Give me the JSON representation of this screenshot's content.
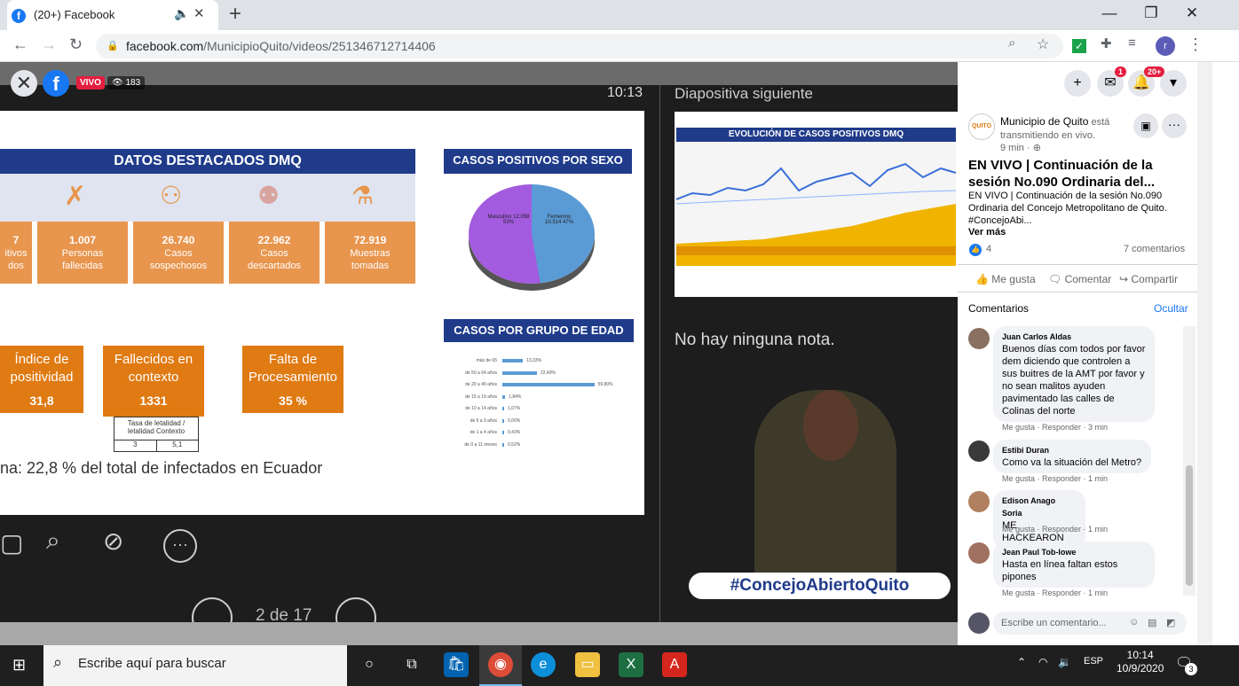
{
  "browser": {
    "tab_title": "(20+) Facebook",
    "url_host": "facebook.com",
    "url_path": "/MunicipioQuito/videos/251346712714406"
  },
  "video": {
    "live_label": "VIVO",
    "viewers": "183",
    "clock": "10:13",
    "next_slide_label": "Diapositiva siguiente",
    "no_notes": "No hay ninguna nota.",
    "pager": "2 de 17",
    "hashtag": "#ConcejoAbiertoQuito",
    "slide": {
      "banner": "DATOS DESTACADOS DMQ",
      "stats": [
        {
          "value": "7",
          "label": "itivos\ndos"
        },
        {
          "value": "1.007",
          "label": "Personas\nfallecidas"
        },
        {
          "value": "26.740",
          "label": "Casos\nsospechosos"
        },
        {
          "value": "22.962",
          "label": "Casos\ndescartados"
        },
        {
          "value": "72.919",
          "label": "Muestras\ntomadas"
        }
      ],
      "boxes": [
        {
          "title": "Índice de positividad",
          "value": "31,8"
        },
        {
          "title": "Fallecidos en contexto",
          "value": "1331"
        },
        {
          "title": "Falta de Procesamiento",
          "value": "35 %"
        }
      ],
      "lethal_head": "Tasa de letalidad / letalidad Contexto",
      "lethal_a": "3",
      "lethal_b": "5,1",
      "footnote": "na: 22,8 % del total de infectados en Ecuador",
      "sex_title": "CASOS POSITIVOS POR SEXO DMQ",
      "pie_m": "Masculino 12.058 53%",
      "pie_f": "Femenino 10.514 47%",
      "age_title": "CASOS POR GRUPO DE EDAD",
      "next_title": "EVOLUCIÓN DE CASOS POSITIVOS DMQ"
    }
  },
  "chart_data": {
    "type": "bar",
    "title": "CASOS POR GRUPO DE EDAD",
    "categories": [
      "más de 65",
      "de 50 a 64 años",
      "de 20 a 49 años",
      "de 15 a 19 años",
      "de 10 a 14 años",
      "de 5 a 9 años",
      "de 1 a 4 años",
      "de 0 a 11 meses"
    ],
    "values": [
      13.33,
      22.49,
      59.8,
      1.84,
      1.07,
      0.0,
      0.43,
      0.52
    ],
    "value_labels": [
      "13,33%",
      "22,49%",
      "59,80%",
      "1,84%",
      "1,07%",
      "0,00%",
      "0,43%",
      "0,52%"
    ]
  },
  "panel": {
    "messenger_badge": "1",
    "notif_badge": "20+",
    "page_name": "Municipio de Quito",
    "page_status": " está transmitiendo en vivo.",
    "time": "9 min · ",
    "title": "EN VIVO | Continuación de la sesión No.090 Ordinaria del...",
    "description": "EN VIVO | Continuación de la sesión No.090 Ordinaria del Concejo Metropolitano de Quito. #ConcejoAbi...",
    "see_more": "Ver más",
    "likes": "4",
    "comments_count": "7 comentarios",
    "like_btn": "Me gusta",
    "comment_btn": "Comentar",
    "share_btn": "Compartir",
    "comments_title": "Comentarios",
    "hide": "Ocultar",
    "comments": [
      {
        "name": "Juan Carlos Aldas",
        "text": "Buenos días com todos por favor dem diciendo que controlen a sus buitres de la AMT por favor y no sean malitos ayuden pavimentado las calles de Colinas del norte",
        "meta": "Me gusta · Responder · 3 min"
      },
      {
        "name": "Estibi Duran",
        "text": "Como va la situación del Metro?",
        "meta": "Me gusta · Responder · 1 min"
      },
      {
        "name": "Edison Anago Soria",
        "text": "ME HACKEARON",
        "meta": "Me gusta · Responder · 1 min"
      },
      {
        "name": "Jean Paul Tob-lowe",
        "text": "Hasta en línea faltan estos pipones",
        "meta": "Me gusta · Responder · 1 min"
      }
    ],
    "write_placeholder": "Escribe un comentario..."
  },
  "taskbar": {
    "search": "Escribe aquí para buscar",
    "lang": "ESP",
    "time": "10:14",
    "date": "10/9/2020",
    "notif": "3"
  }
}
